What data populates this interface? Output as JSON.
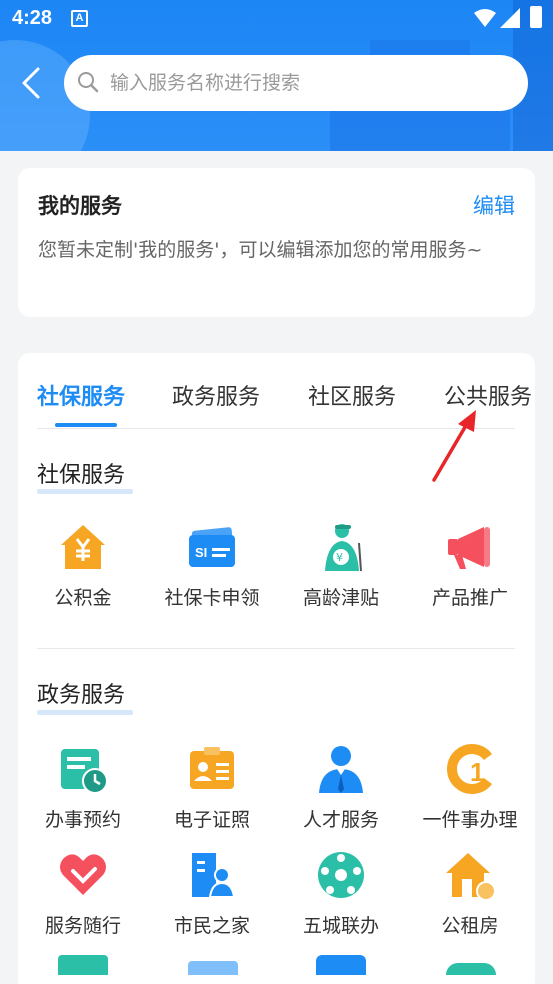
{
  "status": {
    "time": "4:28",
    "notif": "A"
  },
  "search": {
    "placeholder": "输入服务名称进行搜索"
  },
  "my_services": {
    "title": "我的服务",
    "edit_label": "编辑",
    "description": "您暂未定制'我的服务'，可以编辑添加您的常用服务~"
  },
  "tabs": [
    {
      "label": "社保服务"
    },
    {
      "label": "政务服务"
    },
    {
      "label": "社区服务"
    },
    {
      "label": "公共服务"
    }
  ],
  "sections": {
    "social": {
      "title": "社保服务",
      "items": [
        {
          "label": "公积金",
          "icon": "housing-fund-icon"
        },
        {
          "label": "社保卡申领",
          "icon": "social-card-icon"
        },
        {
          "label": "高龄津贴",
          "icon": "elderly-allowance-icon"
        },
        {
          "label": "产品推广",
          "icon": "megaphone-icon"
        }
      ]
    },
    "government": {
      "title": "政务服务",
      "items": [
        {
          "label": "办事预约",
          "icon": "appointment-icon"
        },
        {
          "label": "电子证照",
          "icon": "e-license-icon"
        },
        {
          "label": "人才服务",
          "icon": "talent-icon"
        },
        {
          "label": "一件事办理",
          "icon": "one-thing-icon"
        },
        {
          "label": "服务随行",
          "icon": "heart-service-icon"
        },
        {
          "label": "市民之家",
          "icon": "citizen-home-icon"
        },
        {
          "label": "五城联办",
          "icon": "five-city-icon"
        },
        {
          "label": "公租房",
          "icon": "public-rental-icon"
        }
      ]
    }
  },
  "colors": {
    "primary": "#1d8cf4",
    "header": "#1c86f5",
    "orange": "#f7a623",
    "teal": "#2bbfa8",
    "red": "#f4505e"
  }
}
